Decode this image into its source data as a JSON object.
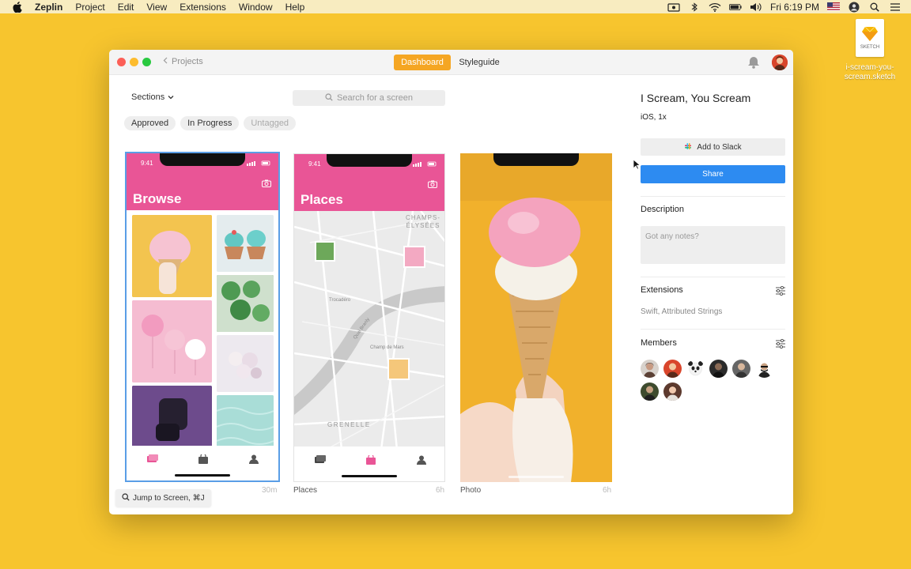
{
  "menubar": {
    "app": "Zeplin",
    "items": [
      "Project",
      "Edit",
      "View",
      "Extensions",
      "Window",
      "Help"
    ],
    "clock": "Fri 6:19 PM"
  },
  "desktop_file": {
    "name": "i-scream-you-scream.sketch",
    "tag": "SKETCH"
  },
  "titlebar": {
    "back_label": "Projects",
    "tab_dashboard": "Dashboard",
    "tab_styleguide": "Styleguide"
  },
  "toolbar": {
    "sections_label": "Sections",
    "search_placeholder": "Search for a screen"
  },
  "filters": [
    "Approved",
    "In Progress",
    "Untagged"
  ],
  "screens": [
    {
      "title": "Browse",
      "caption": "",
      "time": "30m",
      "status_time": "9:41"
    },
    {
      "title": "Places",
      "caption": "Places",
      "time": "6h",
      "status_time": "9:41",
      "map_labels": [
        "CHAMPS-ÉLYSÉES",
        "GRENELLE",
        "Trocadéro",
        "Champ de Mars",
        "Quai Branly"
      ]
    },
    {
      "title": "",
      "caption": "Photo",
      "time": "6h"
    }
  ],
  "jump": {
    "label": "Jump to Screen, ⌘J"
  },
  "sidebar": {
    "project_title": "I Scream, You Scream",
    "platform": "iOS, 1x",
    "slack_button": "Add to Slack",
    "share_button": "Share",
    "description_heading": "Description",
    "notes_placeholder": "Got any notes?",
    "extensions_heading": "Extensions",
    "extensions_text": "Swift, Attributed Strings",
    "members_heading": "Members",
    "members": [
      "member-1",
      "member-2",
      "member-3",
      "member-4",
      "member-5",
      "member-6",
      "member-7",
      "member-8"
    ]
  },
  "colors": {
    "desktop": "#f7c52e",
    "accent": "#f5a623",
    "share": "#2d8bf1",
    "pink": "#e95596",
    "selection": "#5a9ee6"
  }
}
